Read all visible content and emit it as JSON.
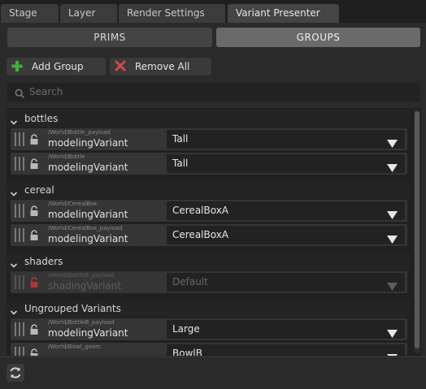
{
  "tabs": [
    {
      "label": "Stage",
      "active": false
    },
    {
      "label": "Layer",
      "active": false
    },
    {
      "label": "Render Settings",
      "active": false
    },
    {
      "label": "Variant Presenter",
      "active": true
    }
  ],
  "mode": {
    "prims": "PRIMS",
    "groups": "GROUPS",
    "selected": "GROUPS"
  },
  "toolbar": {
    "add_group": "Add Group",
    "remove_all": "Remove All"
  },
  "search": {
    "placeholder": "Search"
  },
  "groups": [
    {
      "name": "bottles",
      "rows": [
        {
          "path": "/World/Bottle_payload",
          "variant_set": "modelingVariant",
          "value": "Tall",
          "locked": false
        },
        {
          "path": "/World/Bottle",
          "variant_set": "modelingVariant",
          "value": "Tall",
          "locked": false
        }
      ]
    },
    {
      "name": "cereal",
      "rows": [
        {
          "path": "/World/CerealBox",
          "variant_set": "modelingVariant",
          "value": "CerealBoxA",
          "locked": false
        },
        {
          "path": "/World/CerealBox_payload",
          "variant_set": "modelingVariant",
          "value": "CerealBoxA",
          "locked": false
        }
      ]
    },
    {
      "name": "shaders",
      "rows": [
        {
          "path": "/World/BottleB_payload",
          "variant_set": "shadingVariant",
          "value": "Default",
          "locked": true
        }
      ]
    },
    {
      "name": "Ungrouped Variants",
      "rows": [
        {
          "path": "/World/BottleB_payload",
          "variant_set": "modelingVariant",
          "value": "Large",
          "locked": false
        },
        {
          "path": "/World/Bowl_geom",
          "variant_set": "",
          "value": "BowlB",
          "locked": false
        }
      ]
    }
  ],
  "colors": {
    "accent_add": "#3fae3f",
    "accent_remove": "#d24a4a",
    "lock_active": "#b8b8b8",
    "lock_disabled": "#a33a3a"
  }
}
